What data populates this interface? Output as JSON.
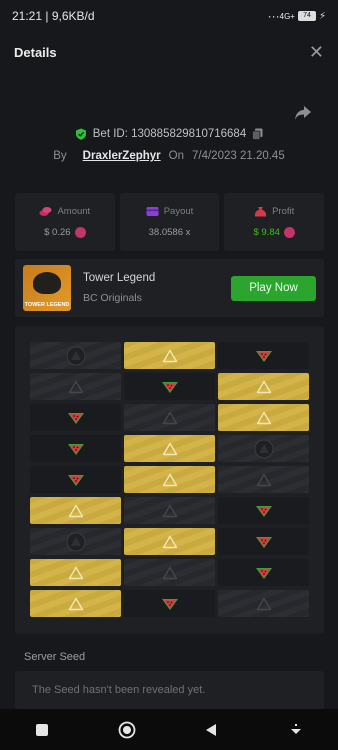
{
  "status_bar": {
    "time_info": "21:21 | 9,6KB/d",
    "dots": "···",
    "network": "4G+",
    "battery": "74"
  },
  "header": {
    "title": "Details",
    "close_icon": "close-icon"
  },
  "bet": {
    "id_label": "Bet ID: 130885829810716684",
    "by_label": "By",
    "user": "DraxlerZephyr",
    "on_label": "On",
    "datetime": "7/4/2023 21.20.45"
  },
  "stats": {
    "amount": {
      "label": "Amount",
      "value": "$ 0.26"
    },
    "payout": {
      "label": "Payout",
      "value": "38.0586 x"
    },
    "profit": {
      "label": "Profit",
      "value": "$ 9.84"
    }
  },
  "game": {
    "name": "Tower Legend",
    "provider": "BC Originals",
    "thumb_text": "TOWER LEGEND",
    "play_label": "Play Now"
  },
  "board": {
    "rows": [
      [
        "closed-skull",
        "win",
        "melon"
      ],
      [
        "closed",
        "melon",
        "win"
      ],
      [
        "melon",
        "closed",
        "win"
      ],
      [
        "melon",
        "win",
        "closed-skull"
      ],
      [
        "melon",
        "win",
        "closed"
      ],
      [
        "win",
        "closed",
        "melon"
      ],
      [
        "closed-skull",
        "win",
        "melon"
      ],
      [
        "win",
        "closed",
        "melon"
      ],
      [
        "win",
        "melon",
        "closed"
      ]
    ]
  },
  "seed": {
    "label": "Server Seed",
    "text": "The Seed hasn't been revealed yet."
  },
  "colors": {
    "win": "#d0b045",
    "play_button": "#2ca52f",
    "profit_green": "#3bc117",
    "background": "#17181b"
  }
}
